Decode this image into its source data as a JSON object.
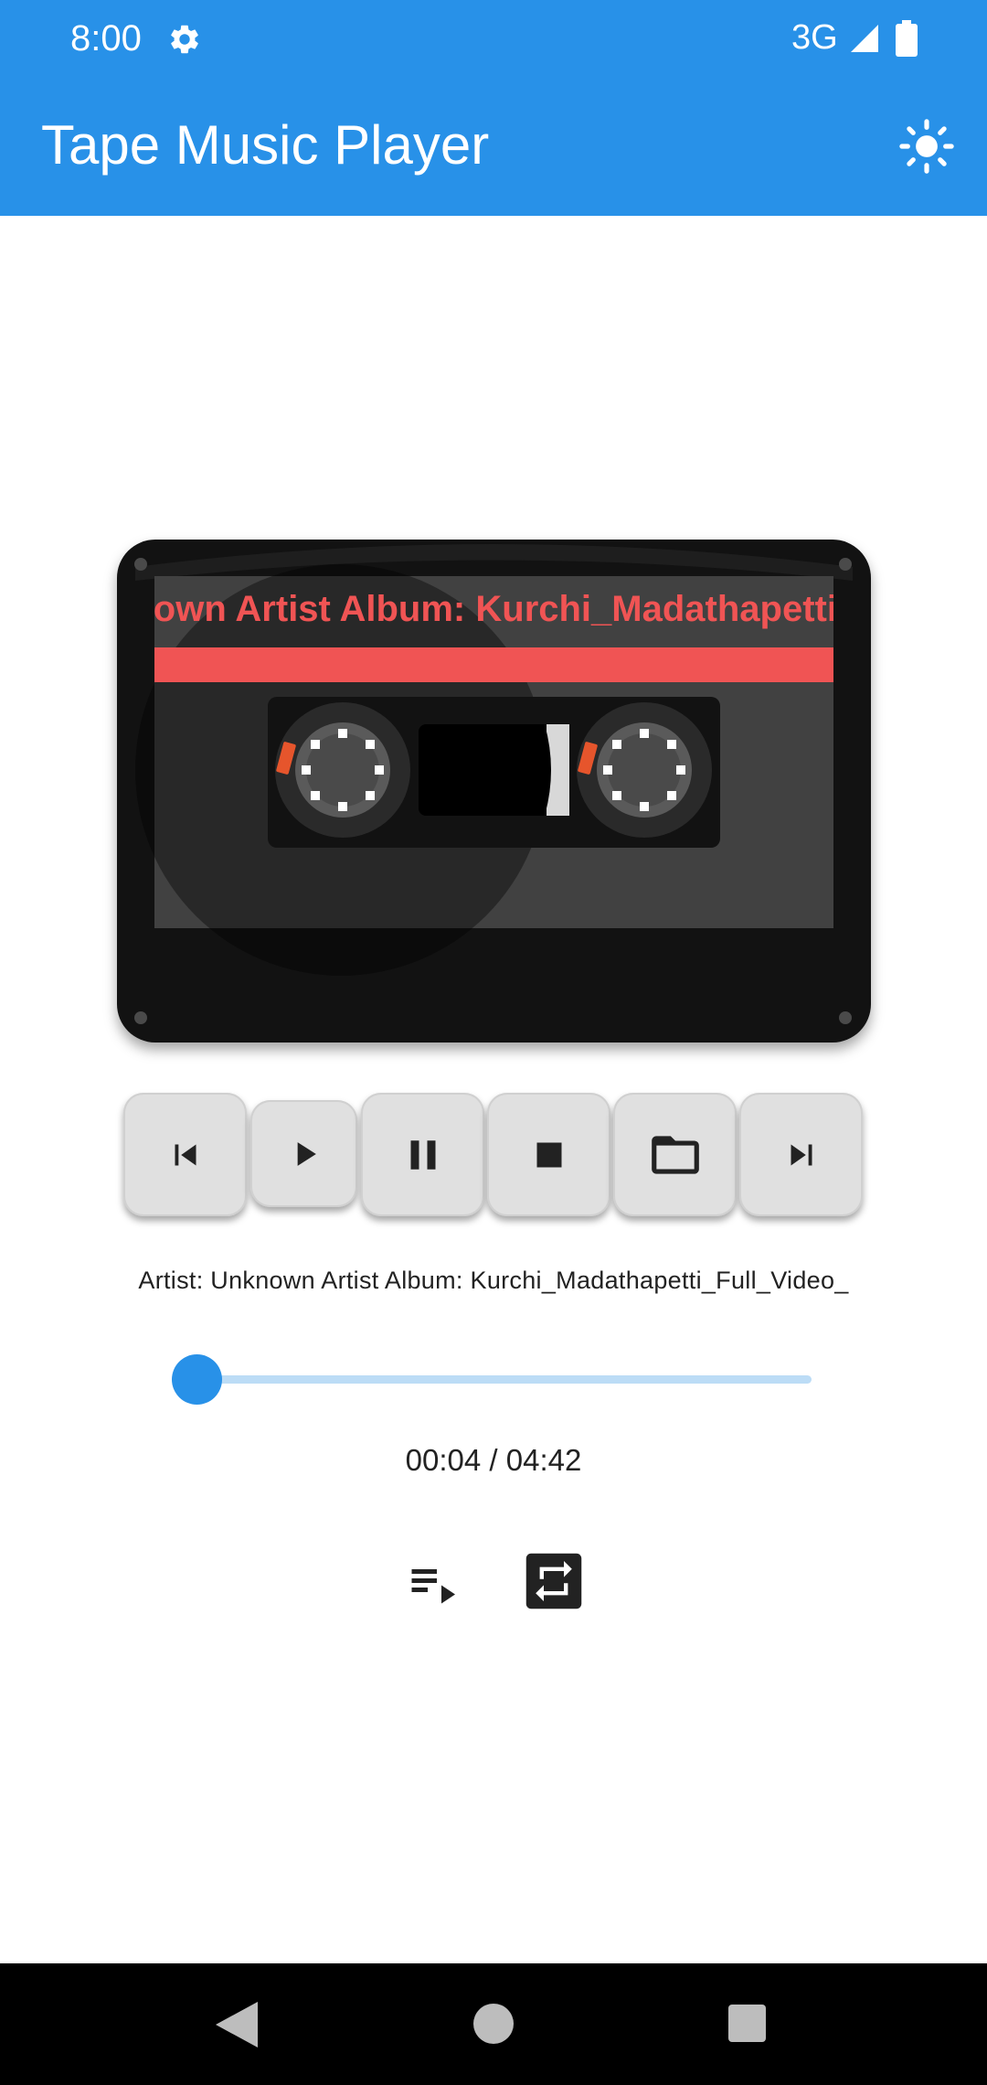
{
  "status_bar": {
    "time": "8:00",
    "network": "3G",
    "icons": [
      "settings-gear-icon",
      "signal-icon",
      "battery-icon"
    ]
  },
  "app_bar": {
    "title": "Tape Music Player",
    "theme_toggle_icon": "brightness-sun-icon"
  },
  "cassette": {
    "label_text": "Artist: Unknown Artist Album: Kurchi_Madathapetti_Full_Video_",
    "label_color": "#f05454"
  },
  "controls": {
    "buttons": [
      {
        "name": "previous",
        "icon": "skip-previous-icon"
      },
      {
        "name": "play",
        "icon": "play-icon"
      },
      {
        "name": "pause",
        "icon": "pause-icon"
      },
      {
        "name": "stop",
        "icon": "stop-icon"
      },
      {
        "name": "open-folder",
        "icon": "folder-icon"
      },
      {
        "name": "next",
        "icon": "skip-next-icon"
      }
    ]
  },
  "track": {
    "info": "Artist: Unknown Artist Album: Kurchi_Madathapetti_Full_Video_",
    "elapsed": "00:04",
    "duration": "04:42",
    "time_display": "00:04 / 04:42",
    "progress_fraction": 0.014
  },
  "extras": {
    "playlist_icon": "playlist-play-icon",
    "repeat_icon": "repeat-icon"
  },
  "nav_bar": {
    "icons": [
      "back-icon",
      "home-icon",
      "recents-icon"
    ]
  },
  "colors": {
    "accent": "#2891e8",
    "slider_track": "#bcdcf6",
    "button_bg": "#e0e0e0"
  }
}
